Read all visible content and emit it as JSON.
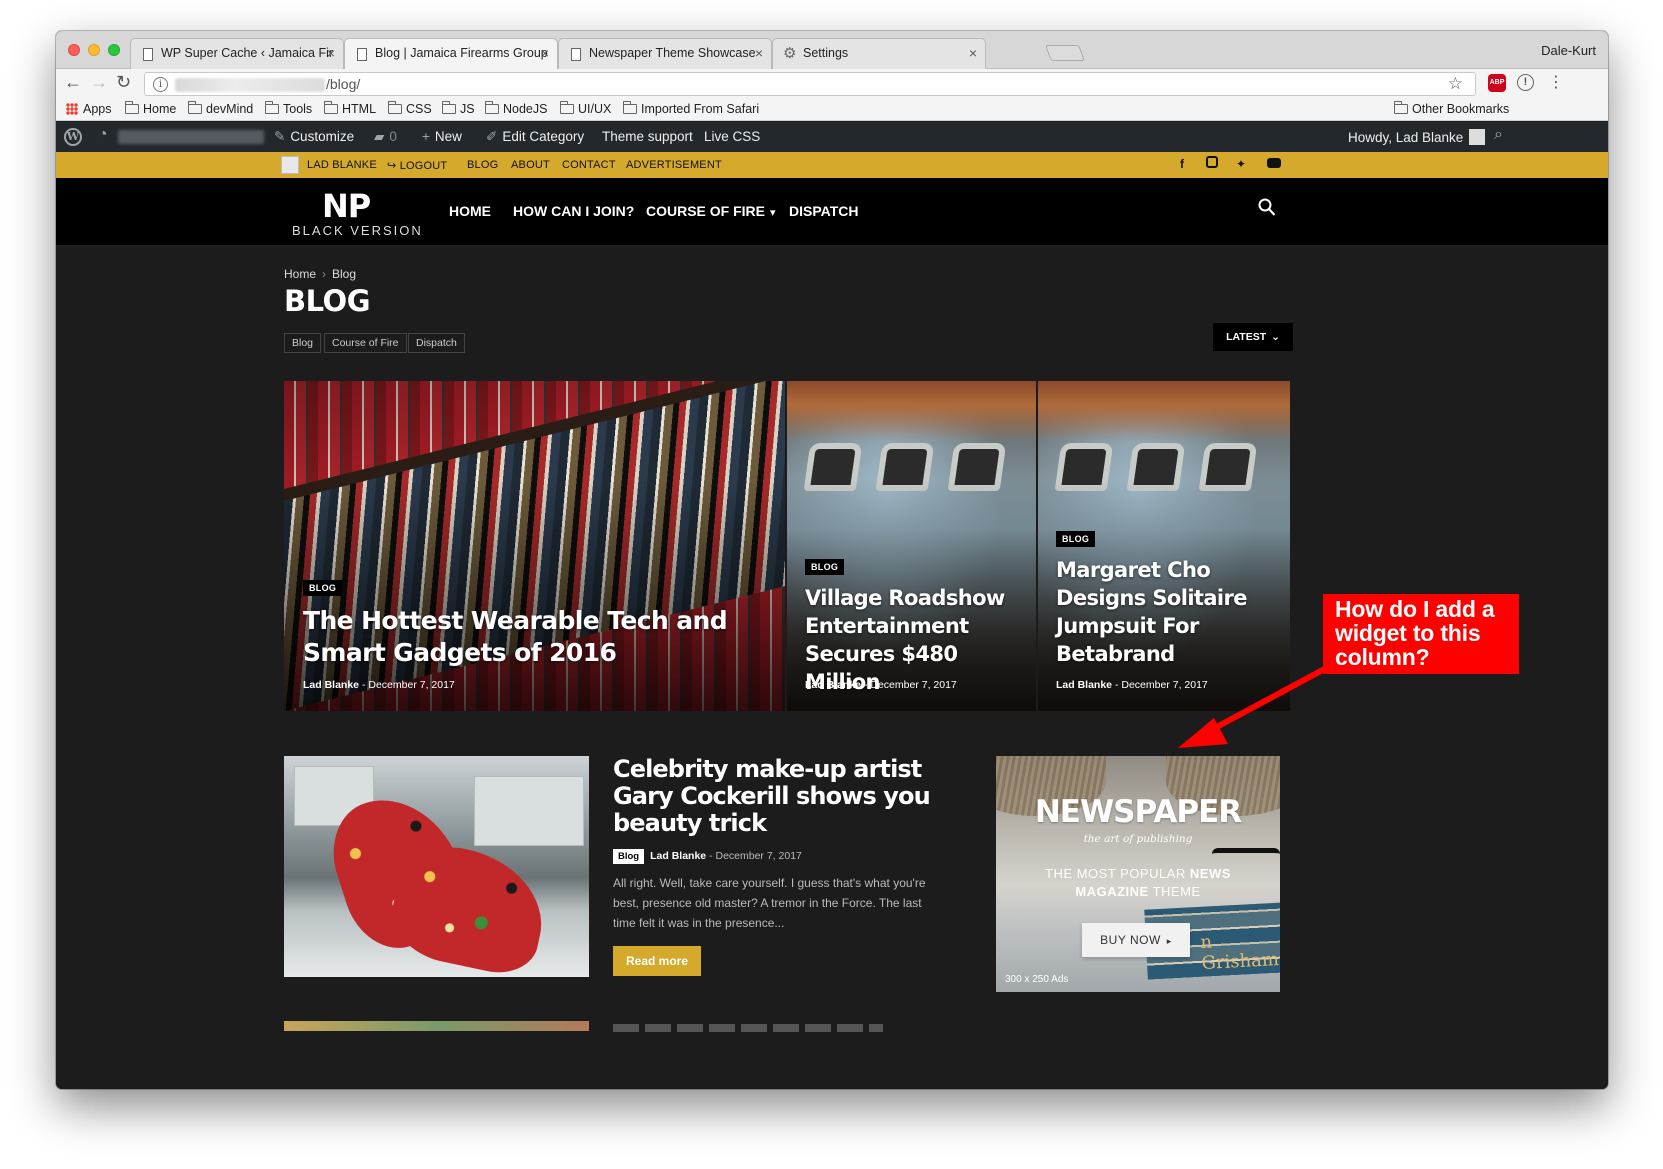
{
  "browser": {
    "tabs": [
      {
        "title": "WP Super Cache ‹ Jamaica Fir",
        "icon": "doc-icon",
        "active": false
      },
      {
        "title": "Blog | Jamaica Firearms Group",
        "icon": "doc-icon",
        "active": true
      },
      {
        "title": "Newspaper Theme Showcase",
        "icon": "doc-icon",
        "active": false
      },
      {
        "title": "Settings",
        "icon": "gear-icon",
        "active": false
      }
    ],
    "tab_close": "×",
    "profile_name": "Dale-Kurt",
    "url_path": "/blog/",
    "bookmarks": [
      {
        "label": "Apps",
        "icon": "apps-icon"
      },
      {
        "label": "Home",
        "icon": "folder-icon"
      },
      {
        "label": "devMind",
        "icon": "folder-icon"
      },
      {
        "label": "Tools",
        "icon": "folder-icon"
      },
      {
        "label": "HTML",
        "icon": "folder-icon"
      },
      {
        "label": "CSS",
        "icon": "folder-icon"
      },
      {
        "label": "JS",
        "icon": "folder-icon"
      },
      {
        "label": "NodeJS",
        "icon": "folder-icon"
      },
      {
        "label": "UI/UX",
        "icon": "folder-icon"
      },
      {
        "label": "Imported From Safari",
        "icon": "folder-icon"
      }
    ],
    "other_bookmarks": "Other Bookmarks"
  },
  "adminbar": {
    "customize": "Customize",
    "comments_count": "0",
    "new": "New",
    "edit_category": "Edit Category",
    "theme_support": "Theme support",
    "live_css": "Live CSS",
    "howdy": "Howdy, Lad Blanke"
  },
  "topbar": {
    "user": "LAD BLANKE",
    "logout": "LOGOUT",
    "links": [
      "BLOG",
      "ABOUT",
      "CONTACT",
      "ADVERTISEMENT"
    ],
    "social": [
      "facebook-icon",
      "instagram-icon",
      "twitter-icon",
      "youtube-icon"
    ],
    "accent_color": "#d4a92c"
  },
  "header": {
    "logo_main": "NP",
    "logo_sub": "BLACK VERSION",
    "nav": [
      {
        "label": "HOME"
      },
      {
        "label": "HOW CAN I JOIN?"
      },
      {
        "label": "COURSE OF FIRE"
      },
      {
        "label": "DISPATCH"
      }
    ],
    "nav_dropdown_caret": "⌄"
  },
  "page": {
    "breadcrumb": [
      "Home",
      "Blog"
    ],
    "title": "BLOG",
    "subcategories": [
      "Blog",
      "Course of Fire",
      "Dispatch"
    ],
    "sort_label": "LATEST"
  },
  "featured": [
    {
      "category": "BLOG",
      "title": "The Hottest Wearable Tech and Smart Gadgets of 2016",
      "author": "Lad Blanke",
      "date": "December 7, 2017"
    },
    {
      "category": "BLOG",
      "title": "Village Roadshow Entertainment Secures $480 Million",
      "author": "Lad Blanke",
      "date": "December 7, 2017"
    },
    {
      "category": "BLOG",
      "title": "Margaret Cho Designs Solitaire Jumpsuit For Betabrand",
      "author": "Lad Blanke",
      "date": "December 7, 2017"
    }
  ],
  "post": {
    "title": "Celebrity make-up artist Gary Cockerill shows you beauty trick",
    "category": "Blog",
    "author": "Lad Blanke",
    "date": "December 7, 2017",
    "excerpt": "All right. Well, take care yourself. I guess that's what you're best, presence old master? A tremor in the Force. The last time felt it was in the presence...",
    "read_more": "Read more"
  },
  "ad": {
    "title": "NEWSPAPER",
    "tagline": "the art of publishing",
    "line1_pre": "THE MOST POPULAR ",
    "line1_bold": "NEWS",
    "line2_bold": "MAGAZINE",
    "line2_post": " THEME",
    "books_text": "n Grisham",
    "button": "BUY NOW",
    "size_label": "300 x 250 Ads"
  },
  "annotation": {
    "text": "How do I add a widget to this column?",
    "color": "#ff0000"
  }
}
